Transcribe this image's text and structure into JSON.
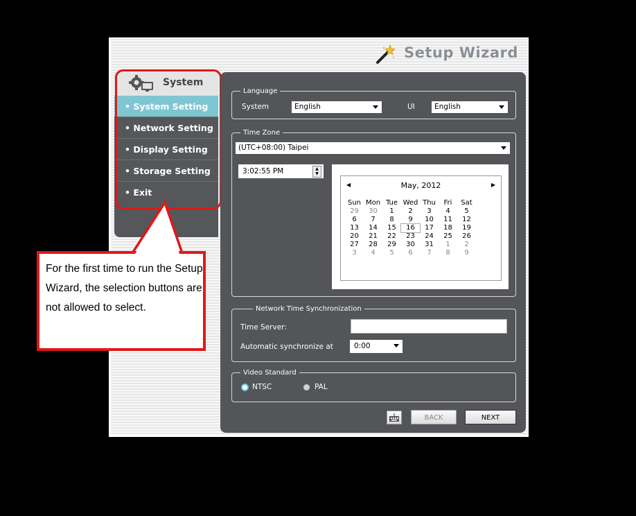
{
  "window": {
    "title": "Setup Wizard"
  },
  "sidebar": {
    "header": "System",
    "items": [
      {
        "label": "• System Setting"
      },
      {
        "label": "• Network Setting"
      },
      {
        "label": "• Display Setting"
      },
      {
        "label": "• Storage Setting"
      },
      {
        "label": "• Exit"
      }
    ]
  },
  "language": {
    "legend": "Language",
    "system_label": "System",
    "system_value": "English",
    "ui_label": "UI",
    "ui_value": "English"
  },
  "timezone": {
    "legend": "Time Zone",
    "value": "(UTC+08:00) Taipei",
    "time": "3:02:55 PM"
  },
  "calendar": {
    "month": "May, 2012",
    "days": [
      "Sun",
      "Mon",
      "Tue",
      "Wed",
      "Thu",
      "Fri",
      "Sat"
    ],
    "weeks": [
      [
        "29",
        "30",
        "1",
        "2",
        "3",
        "4",
        "5"
      ],
      [
        "6",
        "7",
        "8",
        "9",
        "10",
        "11",
        "12"
      ],
      [
        "13",
        "14",
        "15",
        "16",
        "17",
        "18",
        "19"
      ],
      [
        "20",
        "21",
        "22",
        "23",
        "24",
        "25",
        "26"
      ],
      [
        "27",
        "28",
        "29",
        "30",
        "31",
        "1",
        "2"
      ],
      [
        "3",
        "4",
        "5",
        "6",
        "7",
        "8",
        "9"
      ]
    ],
    "selected": "16"
  },
  "ntp": {
    "legend": "Network Time Synchronization",
    "server_label": "Time Server:",
    "server_value": "",
    "auto_label": "Automatic synchronize at",
    "auto_value": "0:00"
  },
  "video": {
    "legend": "Video Standard",
    "ntsc": "NTSC",
    "pal": "PAL",
    "selected": "NTSC"
  },
  "buttons": {
    "back": "BACK",
    "next": "NEXT"
  },
  "callout": "For the first time to run the Setup Wizard, the selection buttons are not allowed to select.",
  "colors": {
    "accent": "#7fc6d3",
    "panel": "#535558",
    "highlight": "#e01818"
  }
}
